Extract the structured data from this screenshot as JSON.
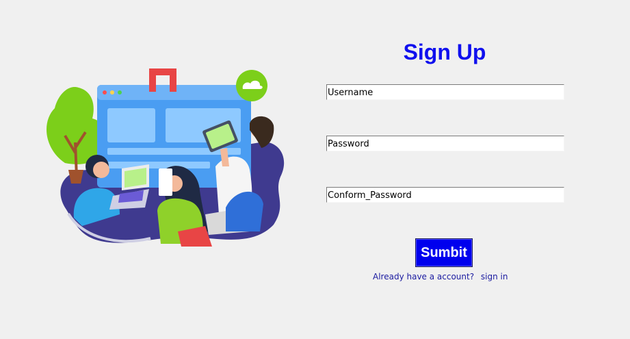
{
  "form": {
    "title": "Sign Up",
    "username_value": "Username",
    "password_value": "Password",
    "confirm_password_value": "Conform_Password",
    "submit_label": "Sumbit",
    "signin_prompt": "Already have a account?",
    "signin_link": "sign in"
  },
  "colors": {
    "title": "#1010ee",
    "button_bg": "#0000ee",
    "link": "#1a1aa0",
    "background": "#f0f0f0"
  }
}
